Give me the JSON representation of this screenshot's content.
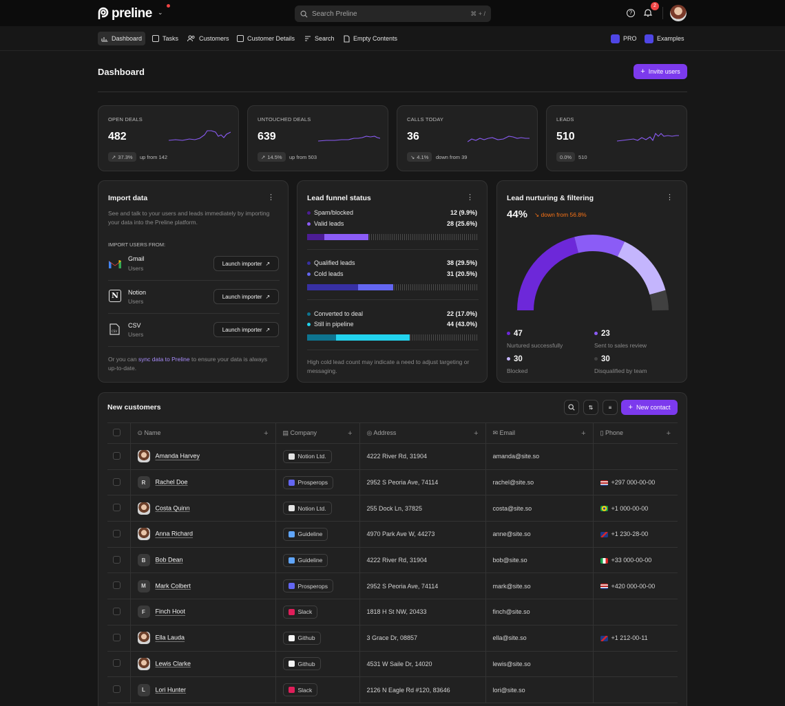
{
  "app": {
    "brand": "preline",
    "search_placeholder": "Search Preline",
    "search_shortcut": "⌘ + /",
    "notif_count": "2"
  },
  "nav": {
    "items": [
      {
        "label": "Dashboard"
      },
      {
        "label": "Tasks"
      },
      {
        "label": "Customers"
      },
      {
        "label": "Customer Details"
      },
      {
        "label": "Search"
      },
      {
        "label": "Empty Contents"
      }
    ],
    "right": [
      {
        "label": "PRO"
      },
      {
        "label": "Examples"
      }
    ]
  },
  "page": {
    "title": "Dashboard",
    "invite_label": "Invite users"
  },
  "stats": [
    {
      "label": "OPEN DEALS",
      "value": "482",
      "badge": "37.3%",
      "note": "up from 142"
    },
    {
      "label": "UNTOUCHED DEALS",
      "value": "639",
      "badge": "14.5%",
      "note": "up from 503"
    },
    {
      "label": "CALLS TODAY",
      "value": "36",
      "badge": "4.1%",
      "note": "down from 39"
    },
    {
      "label": "LEADS",
      "value": "510",
      "badge": "0.0%",
      "note": "510"
    }
  ],
  "import": {
    "title": "Import data",
    "description": "See and talk to your users and leads immediately by importing your data into the Preline platform.",
    "section_label": "IMPORT USERS FROM:",
    "sources": [
      {
        "name": "Gmail",
        "sub": "Users",
        "button": "Launch importer"
      },
      {
        "name": "Notion",
        "sub": "Users",
        "button": "Launch importer"
      },
      {
        "name": "CSV",
        "sub": "Users",
        "button": "Launch importer"
      }
    ],
    "footer_pre": "Or you can ",
    "footer_link": "sync data to Preline",
    "footer_post": " to ensure your data is always up-to-date."
  },
  "funnel": {
    "title": "Lead funnel status",
    "groups": [
      {
        "rows": [
          {
            "label": "Spam/blocked",
            "value": "12 (9.9%)",
            "color": "#4c1d95"
          },
          {
            "label": "Valid leads",
            "value": "28 (25.6%)",
            "color": "#8b5cf6"
          }
        ],
        "segments": [
          9.9,
          25.6
        ]
      },
      {
        "rows": [
          {
            "label": "Qualified leads",
            "value": "38 (29.5%)",
            "color": "#3730a3"
          },
          {
            "label": "Cold leads",
            "value": "31 (20.5%)",
            "color": "#6366f1"
          }
        ],
        "segments": [
          29.5,
          20.5
        ]
      },
      {
        "rows": [
          {
            "label": "Converted to deal",
            "value": "22 (17.0%)",
            "color": "#0e7490"
          },
          {
            "label": "Still in pipeline",
            "value": "44 (43.0%)",
            "color": "#22d3ee"
          }
        ],
        "segments": [
          17.0,
          43.0
        ]
      }
    ],
    "footer": "High cold lead count may indicate a need to adjust targeting or messaging."
  },
  "nurture": {
    "title": "Lead nurturing & filtering",
    "percent": "44%",
    "change": "down from 56.8%",
    "legend": [
      {
        "value": "47",
        "label": "Nurtured successfully",
        "color": "#6d28d9"
      },
      {
        "value": "23",
        "label": "Sent to sales review",
        "color": "#8b5cf6"
      },
      {
        "value": "30",
        "label": "Blocked",
        "color": "#c4b5fd"
      },
      {
        "value": "30",
        "label": "Disqualified by team",
        "color": "#404040"
      }
    ]
  },
  "customers": {
    "title": "New customers",
    "new_contact": "New contact",
    "columns": [
      "Name",
      "Company",
      "Address",
      "Email",
      "Phone"
    ],
    "rows": [
      {
        "initial": "",
        "photo": true,
        "name": "Amanda Harvey",
        "company": "Notion Ltd.",
        "co": "notion",
        "address": "4222 River Rd, 31904",
        "email": "amanda@site.so",
        "phone": "",
        "flag": ""
      },
      {
        "initial": "R",
        "photo": false,
        "name": "Rachel Doe",
        "company": "Prosperops",
        "co": "prosperops",
        "address": "2952 S Peoria Ave, 74114",
        "email": "rachel@site.so",
        "phone": "+297 000-00-00",
        "flag": "us"
      },
      {
        "initial": "",
        "photo": true,
        "name": "Costa Quinn",
        "company": "Notion Ltd.",
        "co": "notion",
        "address": "255 Dock Ln, 37825",
        "email": "costa@site.so",
        "phone": "+1 000-00-00",
        "flag": "br"
      },
      {
        "initial": "",
        "photo": true,
        "name": "Anna Richard",
        "company": "Guideline",
        "co": "guideline",
        "address": "4970 Park Ave W, 44273",
        "email": "anne@site.so",
        "phone": "+1 230-28-00",
        "flag": "gb"
      },
      {
        "initial": "B",
        "photo": false,
        "name": "Bob Dean",
        "company": "Guideline",
        "co": "guideline",
        "address": "4222 River Rd, 31904",
        "email": "bob@site.so",
        "phone": "+33 000-00-00",
        "flag": "it"
      },
      {
        "initial": "M",
        "photo": false,
        "name": "Mark Colbert",
        "company": "Prosperops",
        "co": "prosperops",
        "address": "2952 S Peoria Ave, 74114",
        "email": "mark@site.so",
        "phone": "+420 000-00-00",
        "flag": "us"
      },
      {
        "initial": "F",
        "photo": false,
        "name": "Finch Hoot",
        "company": "Slack",
        "co": "slack",
        "address": "1818 H St NW, 20433",
        "email": "finch@site.so",
        "phone": "",
        "flag": ""
      },
      {
        "initial": "",
        "photo": true,
        "name": "Ella Lauda",
        "company": "Github",
        "co": "github",
        "address": "3 Grace Dr, 08857",
        "email": "ella@site.so",
        "phone": "+1 212-00-11",
        "flag": "gb"
      },
      {
        "initial": "",
        "photo": true,
        "name": "Lewis Clarke",
        "company": "Github",
        "co": "github",
        "address": "4531 W Saile Dr, 14020",
        "email": "lewis@site.so",
        "phone": "",
        "flag": ""
      },
      {
        "initial": "L",
        "photo": false,
        "name": "Lori Hunter",
        "company": "Slack",
        "co": "slack",
        "address": "2126 N Eagle Rd #120, 83646",
        "email": "lori@site.so",
        "phone": "",
        "flag": ""
      }
    ]
  },
  "colors": {
    "accent": "#7c3aed",
    "accent_light": "#a78bfa",
    "down": "#f97316"
  }
}
